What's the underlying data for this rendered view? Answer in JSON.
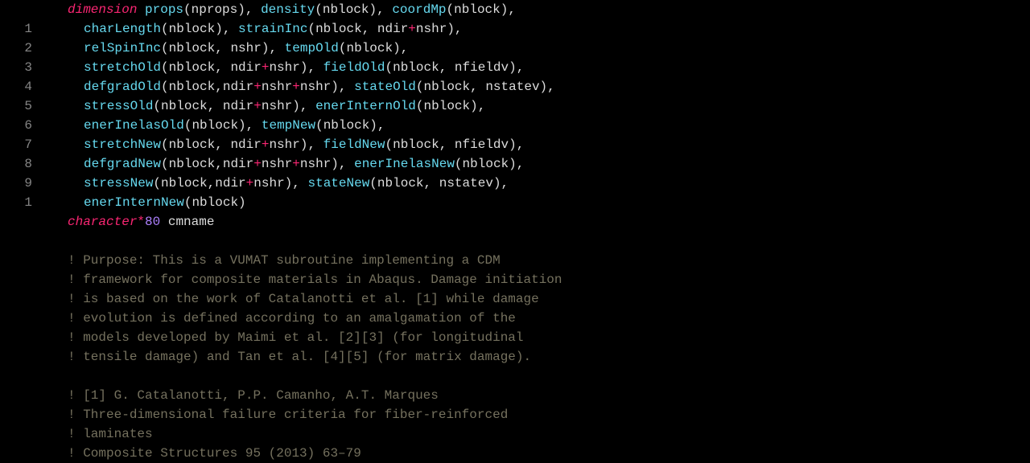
{
  "gutter": [
    "",
    "1",
    "2",
    "3",
    "4",
    "5",
    "6",
    "7",
    "8",
    "9",
    "1",
    "",
    "",
    "",
    "",
    "",
    "",
    "",
    "",
    "",
    "",
    "",
    "",
    ""
  ],
  "lines": [
    {
      "i": 0,
      "t": [
        {
          "c": "kw",
          "s": "dimension "
        },
        {
          "c": "fn",
          "s": "props"
        },
        {
          "c": "pn",
          "s": "("
        },
        {
          "c": "arg",
          "s": "nprops"
        },
        {
          "c": "pn",
          "s": "), "
        },
        {
          "c": "fn",
          "s": "density"
        },
        {
          "c": "pn",
          "s": "("
        },
        {
          "c": "arg",
          "s": "nblock"
        },
        {
          "c": "pn",
          "s": "), "
        },
        {
          "c": "fn",
          "s": "coordMp"
        },
        {
          "c": "pn",
          "s": "("
        },
        {
          "c": "arg",
          "s": "nblock"
        },
        {
          "c": "pn",
          "s": "),"
        }
      ]
    },
    {
      "i": 1,
      "t": [
        {
          "c": "fn",
          "s": "charLength"
        },
        {
          "c": "pn",
          "s": "("
        },
        {
          "c": "arg",
          "s": "nblock"
        },
        {
          "c": "pn",
          "s": "), "
        },
        {
          "c": "fn",
          "s": "strainInc"
        },
        {
          "c": "pn",
          "s": "("
        },
        {
          "c": "arg",
          "s": "nblock, ndir"
        },
        {
          "c": "op",
          "s": "+"
        },
        {
          "c": "arg",
          "s": "nshr"
        },
        {
          "c": "pn",
          "s": "),"
        }
      ]
    },
    {
      "i": 1,
      "t": [
        {
          "c": "fn",
          "s": "relSpinInc"
        },
        {
          "c": "pn",
          "s": "("
        },
        {
          "c": "arg",
          "s": "nblock, nshr"
        },
        {
          "c": "pn",
          "s": "), "
        },
        {
          "c": "fn",
          "s": "tempOld"
        },
        {
          "c": "pn",
          "s": "("
        },
        {
          "c": "arg",
          "s": "nblock"
        },
        {
          "c": "pn",
          "s": "),"
        }
      ]
    },
    {
      "i": 1,
      "t": [
        {
          "c": "fn",
          "s": "stretchOld"
        },
        {
          "c": "pn",
          "s": "("
        },
        {
          "c": "arg",
          "s": "nblock, ndir"
        },
        {
          "c": "op",
          "s": "+"
        },
        {
          "c": "arg",
          "s": "nshr"
        },
        {
          "c": "pn",
          "s": "), "
        },
        {
          "c": "fn",
          "s": "fieldOld"
        },
        {
          "c": "pn",
          "s": "("
        },
        {
          "c": "arg",
          "s": "nblock, nfieldv"
        },
        {
          "c": "pn",
          "s": "),"
        }
      ]
    },
    {
      "i": 1,
      "t": [
        {
          "c": "fn",
          "s": "defgradOld"
        },
        {
          "c": "pn",
          "s": "("
        },
        {
          "c": "arg",
          "s": "nblock,ndir"
        },
        {
          "c": "op",
          "s": "+"
        },
        {
          "c": "arg",
          "s": "nshr"
        },
        {
          "c": "op",
          "s": "+"
        },
        {
          "c": "arg",
          "s": "nshr"
        },
        {
          "c": "pn",
          "s": "), "
        },
        {
          "c": "fn",
          "s": "stateOld"
        },
        {
          "c": "pn",
          "s": "("
        },
        {
          "c": "arg",
          "s": "nblock, nstatev"
        },
        {
          "c": "pn",
          "s": "),"
        }
      ]
    },
    {
      "i": 1,
      "t": [
        {
          "c": "fn",
          "s": "stressOld"
        },
        {
          "c": "pn",
          "s": "("
        },
        {
          "c": "arg",
          "s": "nblock, ndir"
        },
        {
          "c": "op",
          "s": "+"
        },
        {
          "c": "arg",
          "s": "nshr"
        },
        {
          "c": "pn",
          "s": "), "
        },
        {
          "c": "fn",
          "s": "enerInternOld"
        },
        {
          "c": "pn",
          "s": "("
        },
        {
          "c": "arg",
          "s": "nblock"
        },
        {
          "c": "pn",
          "s": "),"
        }
      ]
    },
    {
      "i": 1,
      "t": [
        {
          "c": "fn",
          "s": "enerInelasOld"
        },
        {
          "c": "pn",
          "s": "("
        },
        {
          "c": "arg",
          "s": "nblock"
        },
        {
          "c": "pn",
          "s": "), "
        },
        {
          "c": "fn",
          "s": "tempNew"
        },
        {
          "c": "pn",
          "s": "("
        },
        {
          "c": "arg",
          "s": "nblock"
        },
        {
          "c": "pn",
          "s": "),"
        }
      ]
    },
    {
      "i": 1,
      "t": [
        {
          "c": "fn",
          "s": "stretchNew"
        },
        {
          "c": "pn",
          "s": "("
        },
        {
          "c": "arg",
          "s": "nblock, ndir"
        },
        {
          "c": "op",
          "s": "+"
        },
        {
          "c": "arg",
          "s": "nshr"
        },
        {
          "c": "pn",
          "s": "), "
        },
        {
          "c": "fn",
          "s": "fieldNew"
        },
        {
          "c": "pn",
          "s": "("
        },
        {
          "c": "arg",
          "s": "nblock, nfieldv"
        },
        {
          "c": "pn",
          "s": "),"
        }
      ]
    },
    {
      "i": 1,
      "t": [
        {
          "c": "fn",
          "s": "defgradNew"
        },
        {
          "c": "pn",
          "s": "("
        },
        {
          "c": "arg",
          "s": "nblock,ndir"
        },
        {
          "c": "op",
          "s": "+"
        },
        {
          "c": "arg",
          "s": "nshr"
        },
        {
          "c": "op",
          "s": "+"
        },
        {
          "c": "arg",
          "s": "nshr"
        },
        {
          "c": "pn",
          "s": "), "
        },
        {
          "c": "fn",
          "s": "enerInelasNew"
        },
        {
          "c": "pn",
          "s": "("
        },
        {
          "c": "arg",
          "s": "nblock"
        },
        {
          "c": "pn",
          "s": "),"
        }
      ]
    },
    {
      "i": 1,
      "t": [
        {
          "c": "fn",
          "s": "stressNew"
        },
        {
          "c": "pn",
          "s": "("
        },
        {
          "c": "arg",
          "s": "nblock,ndir"
        },
        {
          "c": "op",
          "s": "+"
        },
        {
          "c": "arg",
          "s": "nshr"
        },
        {
          "c": "pn",
          "s": "), "
        },
        {
          "c": "fn",
          "s": "stateNew"
        },
        {
          "c": "pn",
          "s": "("
        },
        {
          "c": "arg",
          "s": "nblock, nstatev"
        },
        {
          "c": "pn",
          "s": "),"
        }
      ]
    },
    {
      "i": 1,
      "t": [
        {
          "c": "fn",
          "s": "enerInternNew"
        },
        {
          "c": "pn",
          "s": "("
        },
        {
          "c": "arg",
          "s": "nblock"
        },
        {
          "c": "pn",
          "s": ")"
        }
      ]
    },
    {
      "i": 0,
      "t": [
        {
          "c": "kw",
          "s": "character"
        },
        {
          "c": "op",
          "s": "*"
        },
        {
          "c": "num",
          "s": "80"
        },
        {
          "c": "arg",
          "s": " cmname"
        }
      ]
    },
    {
      "i": 0,
      "t": [
        {
          "c": "",
          "s": " "
        }
      ]
    },
    {
      "i": 0,
      "t": [
        {
          "c": "cm",
          "s": "! Purpose: This is a VUMAT subroutine implementing a CDM"
        }
      ]
    },
    {
      "i": 0,
      "t": [
        {
          "c": "cm",
          "s": "! framework for composite materials in Abaqus. Damage initiation"
        }
      ]
    },
    {
      "i": 0,
      "t": [
        {
          "c": "cm",
          "s": "! is based on the work of Catalanotti et al. [1] while damage"
        }
      ]
    },
    {
      "i": 0,
      "t": [
        {
          "c": "cm",
          "s": "! evolution is defined according to an amalgamation of the"
        }
      ]
    },
    {
      "i": 0,
      "t": [
        {
          "c": "cm",
          "s": "! models developed by Maimi et al. [2][3] (for longitudinal"
        }
      ]
    },
    {
      "i": 0,
      "t": [
        {
          "c": "cm",
          "s": "! tensile damage) and Tan et al. [4][5] (for matrix damage)."
        }
      ]
    },
    {
      "i": 0,
      "t": [
        {
          "c": "",
          "s": " "
        }
      ]
    },
    {
      "i": 0,
      "t": [
        {
          "c": "cm",
          "s": "! [1] G. Catalanotti, P.P. Camanho, A.T. Marques"
        }
      ]
    },
    {
      "i": 0,
      "t": [
        {
          "c": "cm",
          "s": "! Three-dimensional failure criteria for fiber-reinforced"
        }
      ]
    },
    {
      "i": 0,
      "t": [
        {
          "c": "cm",
          "s": "! laminates"
        }
      ]
    },
    {
      "i": 0,
      "t": [
        {
          "c": "cm",
          "s": "! Composite Structures 95 (2013) 63–79"
        }
      ]
    }
  ]
}
